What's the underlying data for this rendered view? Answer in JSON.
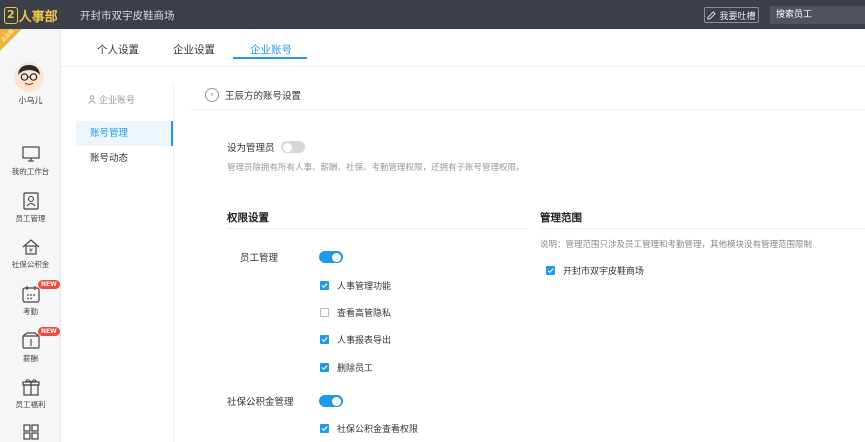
{
  "topbar": {
    "logo_text": "人事部",
    "logo_prefix": "2",
    "company_name": "开封市双宇皮鞋商场",
    "feedback_label": "我要吐槽",
    "search_placeholder": "搜索员工"
  },
  "rail": {
    "corner_badge": "企业版",
    "user_name": "小乌儿",
    "items": [
      {
        "label": "我的工作台",
        "icon": "monitor-icon"
      },
      {
        "label": "员工管理",
        "icon": "employee-icon"
      },
      {
        "label": "社保公积金",
        "icon": "house-icon"
      },
      {
        "label": "考勤",
        "icon": "calendar-icon",
        "badge": "NEW"
      },
      {
        "label": "薪酬",
        "icon": "wallet-icon",
        "badge": "NEW"
      },
      {
        "label": "员工福利",
        "icon": "gift-icon"
      }
    ]
  },
  "tabs": [
    "个人设置",
    "企业设置",
    "企业账号"
  ],
  "active_tab": "企业账号",
  "subnav": {
    "heading": "企业账号",
    "items": [
      "账号管理",
      "账号动态"
    ],
    "active": "账号管理"
  },
  "content": {
    "breadcrumb": "王辰方的账号设置",
    "admin_label": "设为管理员",
    "admin_on": false,
    "admin_desc": "管理员除拥有所有人事、薪酬、社保、考勤管理权限，还拥有子账号管理权限。",
    "permissions_title": "权限设置",
    "scope_title": "管理范围",
    "scope_note": "说明：管理范围只涉及员工管理和考勤管理，其他模块没有管理范围限制",
    "scope_items": [
      {
        "label": "开封市双宇皮鞋商场",
        "checked": true
      }
    ],
    "groups": [
      {
        "label": "员工管理",
        "enabled": true,
        "items": [
          {
            "label": "人事管理功能",
            "checked": true
          },
          {
            "label": "查看高管隐私",
            "checked": false
          },
          {
            "label": "人事报表导出",
            "checked": true
          },
          {
            "label": "删除员工",
            "checked": true
          }
        ]
      },
      {
        "label": "社保公积金管理",
        "enabled": true,
        "items": [
          {
            "label": "社保公积金查看权限",
            "checked": true
          }
        ]
      }
    ]
  },
  "colors": {
    "accent": "#1e9ae8",
    "topbar": "#3b3f48",
    "badge_new": "#f04a3a",
    "logo": "#f0c34a"
  }
}
